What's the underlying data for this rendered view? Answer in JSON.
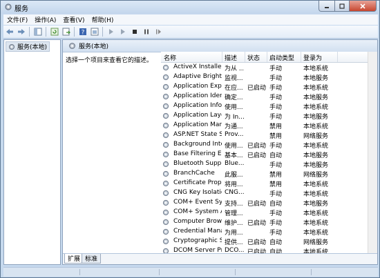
{
  "window": {
    "title": "服务"
  },
  "menubar": [
    "文件(F)",
    "操作(A)",
    "查看(V)",
    "帮助(H)"
  ],
  "tree": {
    "root_label": "服务(本地)"
  },
  "content": {
    "header_title": "服务(本地)",
    "description_hint": "选择一个项目来查看它的描述。"
  },
  "columns": [
    "名称",
    "描述",
    "状态",
    "启动类型",
    "登录为"
  ],
  "services": [
    {
      "name": "ActiveX Installer ...",
      "desc": "为从 ...",
      "status": "",
      "startup": "手动",
      "logon": "本地系统"
    },
    {
      "name": "Adaptive Brightn...",
      "desc": "监视...",
      "status": "",
      "startup": "手动",
      "logon": "本地服务"
    },
    {
      "name": "Application Expe...",
      "desc": "在应...",
      "status": "已启动",
      "startup": "手动",
      "logon": "本地系统"
    },
    {
      "name": "Application Iden...",
      "desc": "确定...",
      "status": "",
      "startup": "手动",
      "logon": "本地服务"
    },
    {
      "name": "Application Infor...",
      "desc": "使用...",
      "status": "",
      "startup": "手动",
      "logon": "本地系统"
    },
    {
      "name": "Application Laye...",
      "desc": "为 In...",
      "status": "",
      "startup": "手动",
      "logon": "本地服务"
    },
    {
      "name": "Application Man...",
      "desc": "为通...",
      "status": "",
      "startup": "禁用",
      "logon": "本地系统"
    },
    {
      "name": "ASP.NET State S...",
      "desc": "Prov...",
      "status": "",
      "startup": "禁用",
      "logon": "网络服务"
    },
    {
      "name": "Background Inte...",
      "desc": "使用...",
      "status": "已启动",
      "startup": "手动",
      "logon": "本地系统"
    },
    {
      "name": "Base Filtering En...",
      "desc": "基本...",
      "status": "已启动",
      "startup": "自动",
      "logon": "本地服务"
    },
    {
      "name": "Bluetooth Supp...",
      "desc": "Blue...",
      "status": "",
      "startup": "手动",
      "logon": "本地服务"
    },
    {
      "name": "BranchCache",
      "desc": "此服...",
      "status": "",
      "startup": "禁用",
      "logon": "网络服务"
    },
    {
      "name": "Certificate Propa...",
      "desc": "将用...",
      "status": "",
      "startup": "禁用",
      "logon": "本地系统"
    },
    {
      "name": "CNG Key Isolation",
      "desc": "CNG...",
      "status": "",
      "startup": "手动",
      "logon": "本地系统"
    },
    {
      "name": "COM+ Event Sys...",
      "desc": "支持...",
      "status": "已启动",
      "startup": "自动",
      "logon": "本地服务"
    },
    {
      "name": "COM+ System A...",
      "desc": "管理...",
      "status": "",
      "startup": "手动",
      "logon": "本地系统"
    },
    {
      "name": "Computer Brow...",
      "desc": "维护...",
      "status": "已启动",
      "startup": "手动",
      "logon": "本地系统"
    },
    {
      "name": "Credential Mana...",
      "desc": "为用...",
      "status": "",
      "startup": "手动",
      "logon": "本地系统"
    },
    {
      "name": "Cryptographic S...",
      "desc": "提供...",
      "status": "已启动",
      "startup": "自动",
      "logon": "网络服务"
    },
    {
      "name": "DCOM Server Pr...",
      "desc": "DCO...",
      "status": "已启动",
      "startup": "自动",
      "logon": "本地系统"
    }
  ],
  "tabs": [
    "扩展",
    "标准"
  ]
}
